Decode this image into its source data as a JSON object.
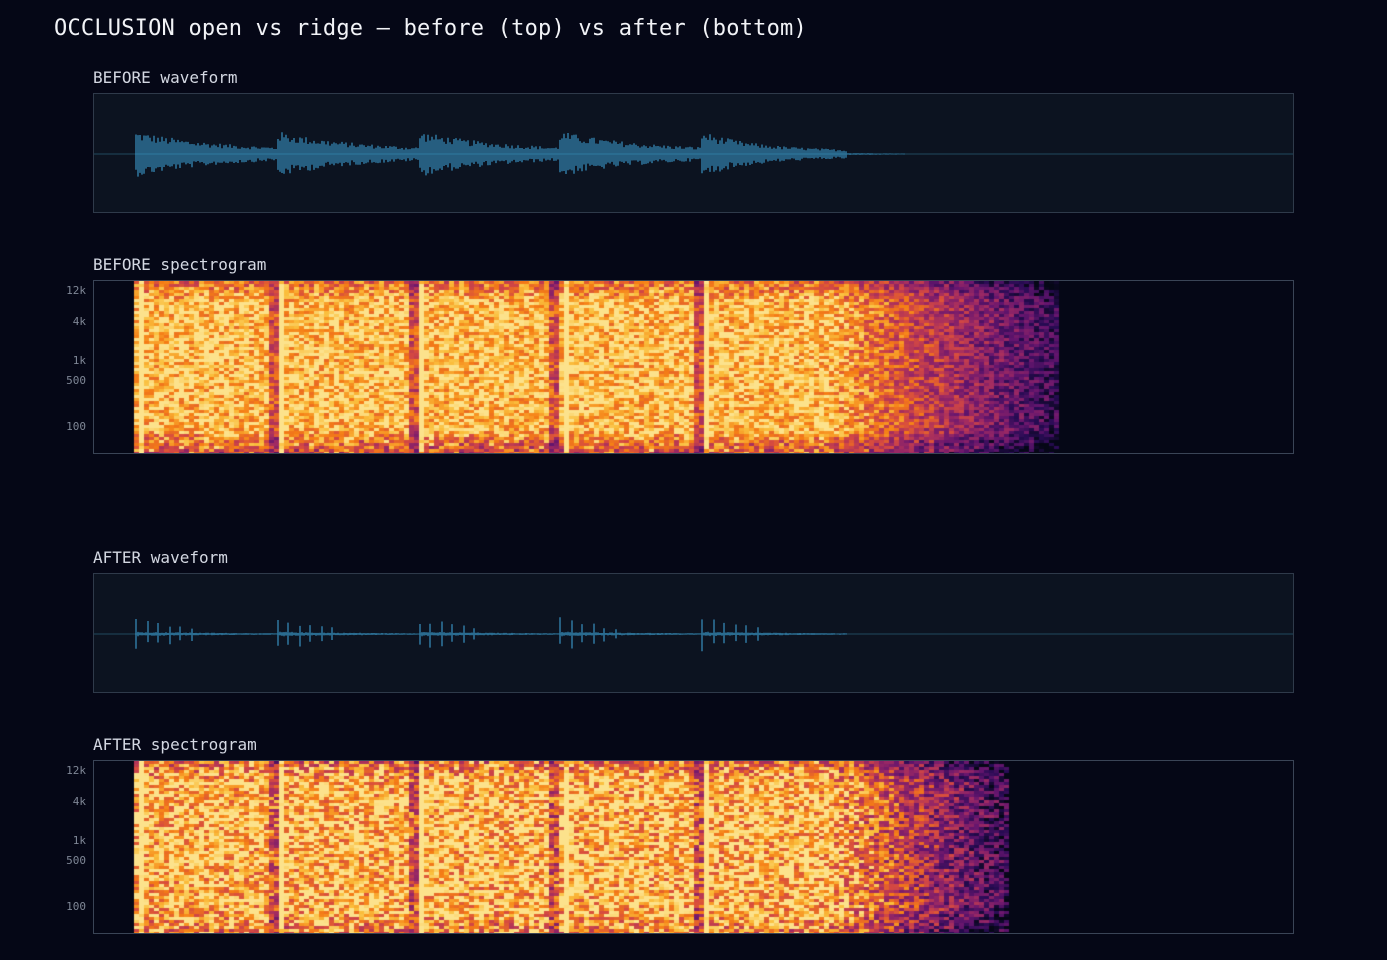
{
  "title": "OCCLUSION open vs ridge — before (top) vs after (bottom)",
  "panels": {
    "before_waveform": {
      "label": "BEFORE waveform"
    },
    "before_spectrogram": {
      "label": "BEFORE spectrogram"
    },
    "after_waveform": {
      "label": "AFTER waveform"
    },
    "after_spectrogram": {
      "label": "AFTER spectrogram"
    }
  },
  "freq_ticks": [
    "12k",
    "4k",
    "1k",
    "500",
    "100"
  ],
  "colors": {
    "background": "#050716",
    "waveform": "#3fa9e0",
    "panel": "#0c1320",
    "border": "#2f3a4a",
    "spectrogram_colormap": "inferno"
  }
}
